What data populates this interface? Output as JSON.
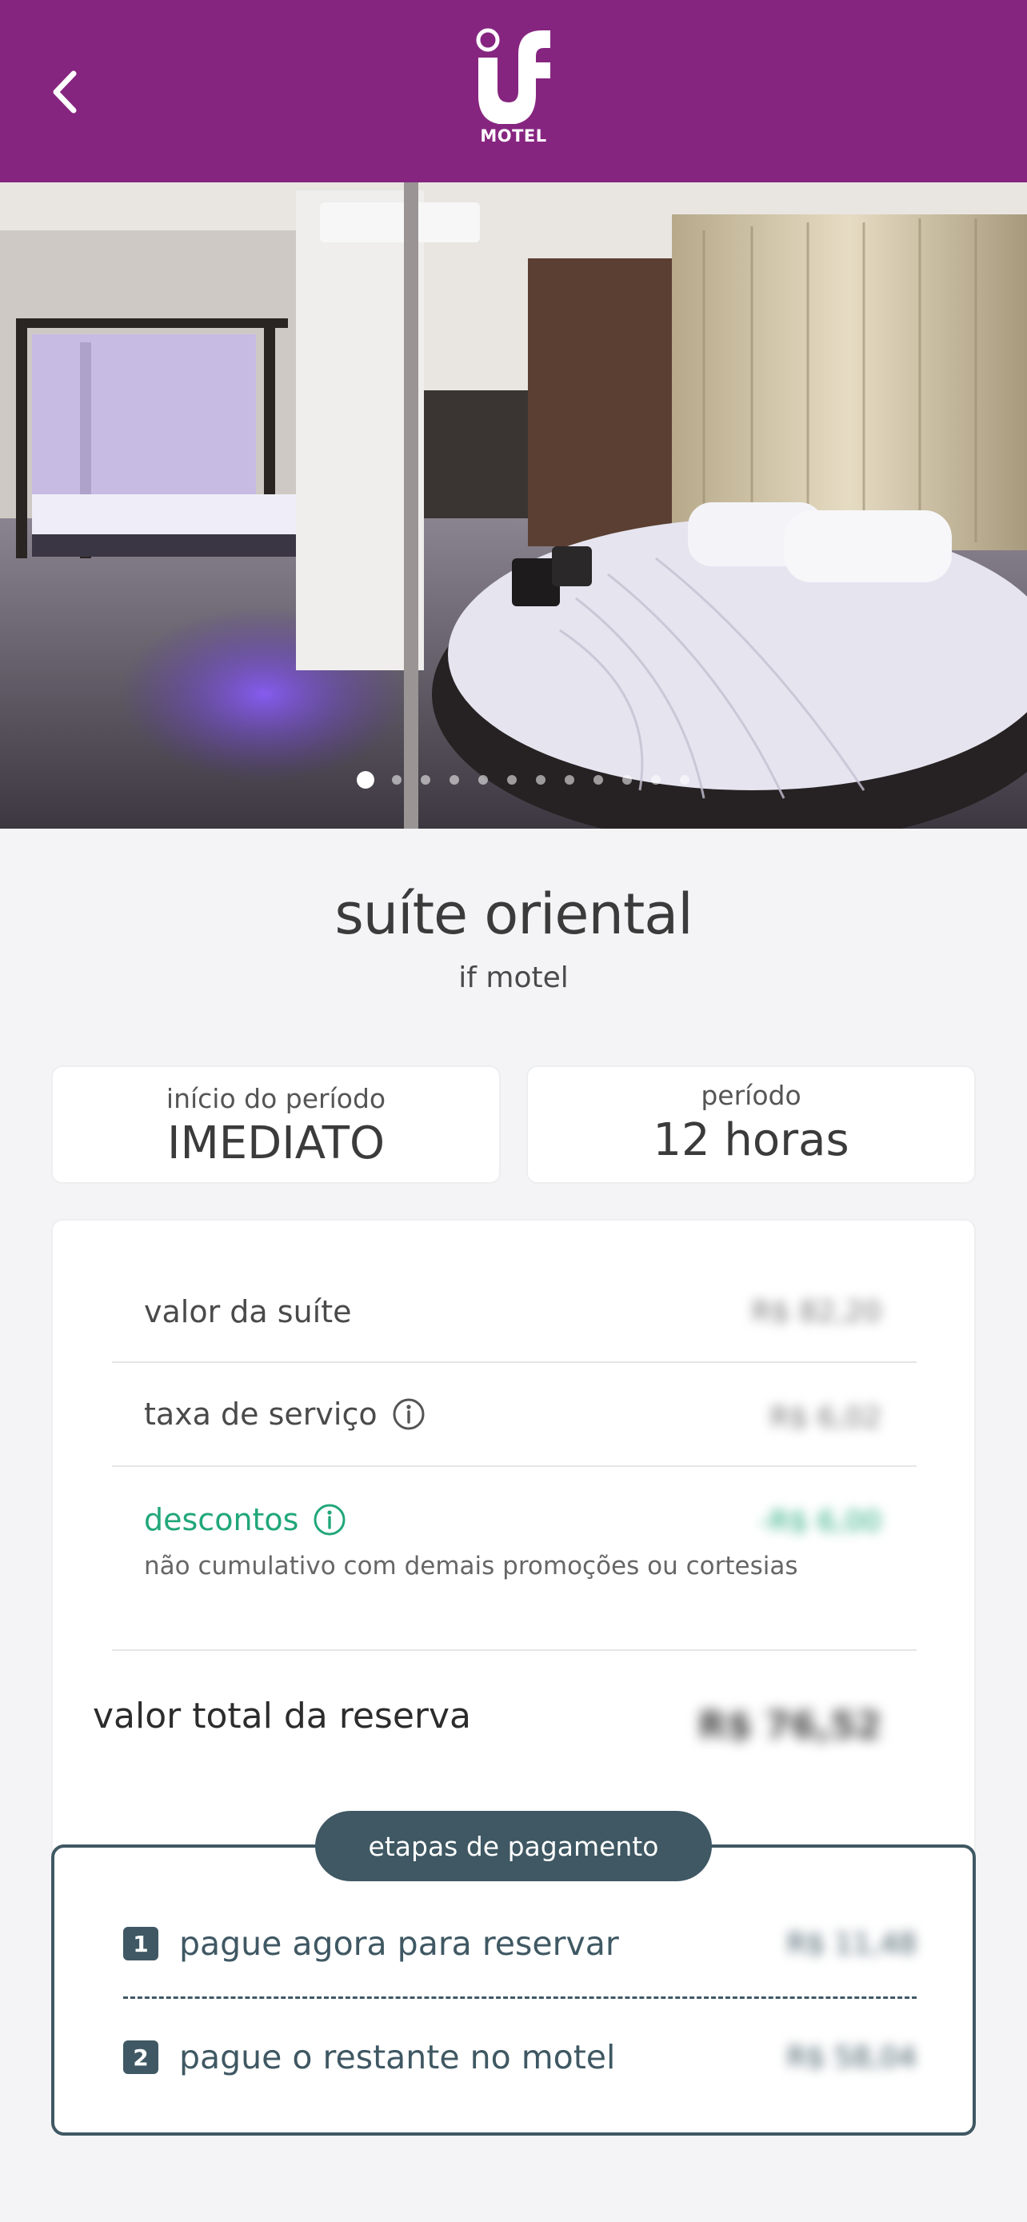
{
  "header": {
    "brand_sub": "MOTEL",
    "colors": {
      "brand": "#862580"
    }
  },
  "gallery": {
    "image_count": 12,
    "active_index": 0
  },
  "suite": {
    "name": "suíte oriental",
    "motel": "if motel"
  },
  "info": {
    "start_label": "início do período",
    "start_value": "IMEDIATO",
    "period_label": "período",
    "period_value": "12 horas"
  },
  "pricing": {
    "suite_label": "valor da suíte",
    "suite_value": "R$ 82,20",
    "service_label": "taxa de serviço",
    "service_value": "R$ 6,02",
    "discount_label": "descontos",
    "discount_value": "-R$ 6,00",
    "discount_note": "não cumulativo com demais promoções ou cortesias",
    "total_label": "valor total da reserva",
    "total_value": "R$ 76,52"
  },
  "payment": {
    "title": "etapas de pagamento",
    "steps": [
      {
        "num": "1",
        "label": "pague agora para reservar",
        "value": "R$ 11,48"
      },
      {
        "num": "2",
        "label": "pague o restante no motel",
        "value": "R$ 58,04"
      }
    ]
  }
}
